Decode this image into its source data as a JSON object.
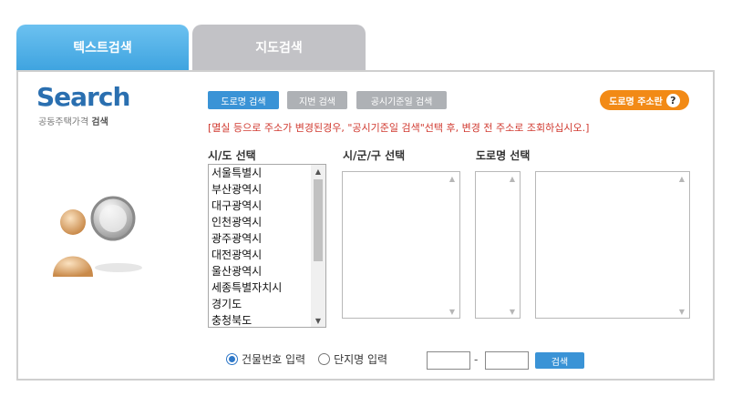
{
  "tabs": {
    "text_search": "텍스트검색",
    "map_search": "지도검색"
  },
  "logo": {
    "title": "Search",
    "subtitle_prefix": "공동주택가격 ",
    "subtitle_bold": "검색"
  },
  "buttons": {
    "road_search": "도로명 검색",
    "jibun_search": "지번 검색",
    "date_search": "공시기준일 검색",
    "road_help": "도로명 주소란",
    "help_mark": "?",
    "search": "검색"
  },
  "notice": "[멸실 등으로 주소가 변경된경우, \"공시기준일 검색\"선택 후, 변경 전 주소로 조회하십시오.]",
  "labels": {
    "sido": "시/도 선택",
    "sigungu": "시/군/구 선택",
    "road": "도로명 선택"
  },
  "sido_options": [
    "서울특별시",
    "부산광역시",
    "대구광역시",
    "인천광역시",
    "광주광역시",
    "대전광역시",
    "울산광역시",
    "세종특별자치시",
    "경기도",
    "충청북도"
  ],
  "radio": {
    "building_number": "건물번호 입력",
    "complex_name": "단지명 입력"
  },
  "inputs": {
    "dash": "-"
  },
  "colors": {
    "tab_active": "#3fa4e0",
    "tab_inactive": "#c2c2c6",
    "primary_button": "#3a93d6",
    "help_button": "#f28a16",
    "notice_text": "#d0392f"
  },
  "icons": {
    "avatar": "user-search-icon",
    "scroll_up": "scroll-up-arrow",
    "scroll_down": "scroll-down-arrow"
  }
}
